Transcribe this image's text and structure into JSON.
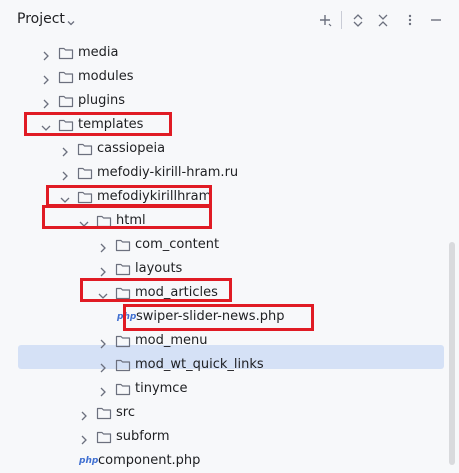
{
  "panel": {
    "title": "Project",
    "buttons": [
      "add-icon",
      "expand-all-icon",
      "collapse-all-icon",
      "more-icon",
      "minimize-icon"
    ]
  },
  "tree": [
    {
      "label": "media",
      "type": "folder",
      "depth": 2,
      "expanded": false
    },
    {
      "label": "modules",
      "type": "folder",
      "depth": 2,
      "expanded": false
    },
    {
      "label": "plugins",
      "type": "folder",
      "depth": 2,
      "expanded": false
    },
    {
      "label": "templates",
      "type": "folder",
      "depth": 2,
      "expanded": true
    },
    {
      "label": "cassiopeia",
      "type": "folder",
      "depth": 3,
      "expanded": false
    },
    {
      "label": "mefodiy-kirill-hram.ru",
      "type": "folder",
      "depth": 3,
      "expanded": false
    },
    {
      "label": "mefodiykirillhram",
      "type": "folder",
      "depth": 3,
      "expanded": true
    },
    {
      "label": "html",
      "type": "folder",
      "depth": 4,
      "expanded": true
    },
    {
      "label": "com_content",
      "type": "folder",
      "depth": 5,
      "expanded": false
    },
    {
      "label": "layouts",
      "type": "folder",
      "depth": 5,
      "expanded": false
    },
    {
      "label": "mod_articles",
      "type": "folder",
      "depth": 5,
      "expanded": true
    },
    {
      "label": "swiper-slider-news.php",
      "type": "php",
      "depth": 6,
      "selected": true
    },
    {
      "label": "mod_menu",
      "type": "folder",
      "depth": 5,
      "expanded": false
    },
    {
      "label": "mod_wt_quick_links",
      "type": "folder",
      "depth": 5,
      "expanded": false
    },
    {
      "label": "tinymce",
      "type": "folder",
      "depth": 5,
      "expanded": false
    },
    {
      "label": "src",
      "type": "folder",
      "depth": 4,
      "expanded": false
    },
    {
      "label": "subform",
      "type": "folder",
      "depth": 4,
      "expanded": false
    },
    {
      "label": "component.php",
      "type": "php",
      "depth": 4
    }
  ],
  "php_badge": "php",
  "colors": {
    "highlight": "#e01b24",
    "selection": "#d5e1f6",
    "php": "#3f6fd1"
  }
}
